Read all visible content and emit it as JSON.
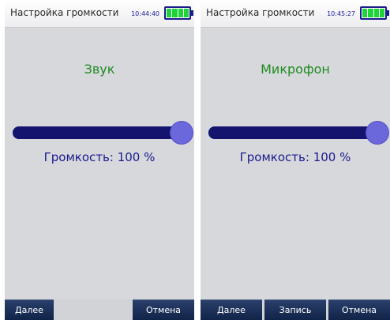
{
  "screens": [
    {
      "title": "Настройка громкости",
      "time": "10:44:40",
      "battery_cells": 4,
      "heading": "Звук",
      "volume_label": "Громкость:",
      "volume_value": "100",
      "volume_unit": "%",
      "volume_level": 1.0,
      "buttons": {
        "next": "Далее",
        "cancel": "Отмена"
      }
    },
    {
      "title": "Настройка громкости",
      "time": "10:45:27",
      "battery_cells": 4,
      "heading": "Микрофон",
      "volume_label": "Громкость:",
      "volume_value": "100",
      "volume_unit": "%",
      "volume_level": 1.0,
      "buttons": {
        "next": "Далее",
        "record": "Запись",
        "cancel": "Отмена"
      }
    }
  ],
  "colors": {
    "heading": "#1f8a1f",
    "accent": "#14146e",
    "slider_thumb": "#6b68dc",
    "battery": "#1fd43a",
    "button": "#1a2d55"
  }
}
